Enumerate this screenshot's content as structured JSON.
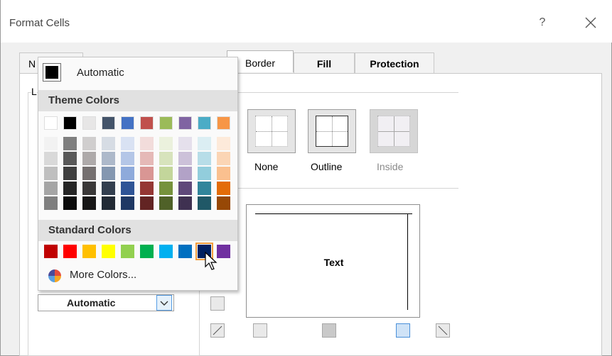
{
  "window": {
    "title": "Format Cells",
    "help_label": "?"
  },
  "tabs": [
    {
      "label": "N"
    },
    {
      "label": "Border",
      "active": true
    },
    {
      "label": "Fill"
    },
    {
      "label": "Protection"
    }
  ],
  "presets": {
    "none_label": "None",
    "outline_label": "Outline",
    "inside_label": "Inside"
  },
  "preview": {
    "text": "Text"
  },
  "line_group": {
    "label_initial": "L"
  },
  "color_combo": {
    "value": "Automatic",
    "arrow_icon": "chevron-down-icon"
  },
  "palette": {
    "automatic_label": "Automatic",
    "theme_header": "Theme Colors",
    "standard_header": "Standard Colors",
    "more_colors_label": "More Colors...",
    "theme_row": [
      "#ffffff",
      "#000000",
      "#e7e6e6",
      "#44546a",
      "#4472c4",
      "#c0504d",
      "#9bbb59",
      "#8064a2",
      "#4bacc6",
      "#f79646"
    ],
    "theme_shades": [
      [
        "#f2f2f2",
        "#7f7f7f",
        "#d0cece",
        "#d6dce4",
        "#d9e2f3",
        "#f2dcdb",
        "#ebf1dd",
        "#e5e0ec",
        "#dbeef3",
        "#fdeada"
      ],
      [
        "#d9d9d9",
        "#595959",
        "#aeaaaa",
        "#adb9ca",
        "#b4c6e7",
        "#e5b9b7",
        "#d7e3bc",
        "#ccc1d9",
        "#b7dde8",
        "#fbd5b5"
      ],
      [
        "#bfbfbf",
        "#3f3f3f",
        "#757070",
        "#8497b0",
        "#8eaadb",
        "#d99694",
        "#c3d69b",
        "#b2a2c7",
        "#92cddc",
        "#fac08f"
      ],
      [
        "#a5a5a5",
        "#262626",
        "#3a3838",
        "#333f4f",
        "#2f5496",
        "#953734",
        "#76923c",
        "#5f497a",
        "#31859b",
        "#e36c09"
      ],
      [
        "#7f7f7f",
        "#0c0c0c",
        "#171616",
        "#222a35",
        "#1f3864",
        "#632423",
        "#4f6128",
        "#3f3151",
        "#205867",
        "#974806"
      ]
    ],
    "standard_row": [
      "#c00000",
      "#ff0000",
      "#ffc000",
      "#ffff00",
      "#92d050",
      "#00b050",
      "#00b0f0",
      "#0070c0",
      "#002060",
      "#7030a0"
    ],
    "selected_standard_index": 8
  },
  "colors": {
    "accent": "#569de5",
    "selection": "#f29b3a"
  }
}
